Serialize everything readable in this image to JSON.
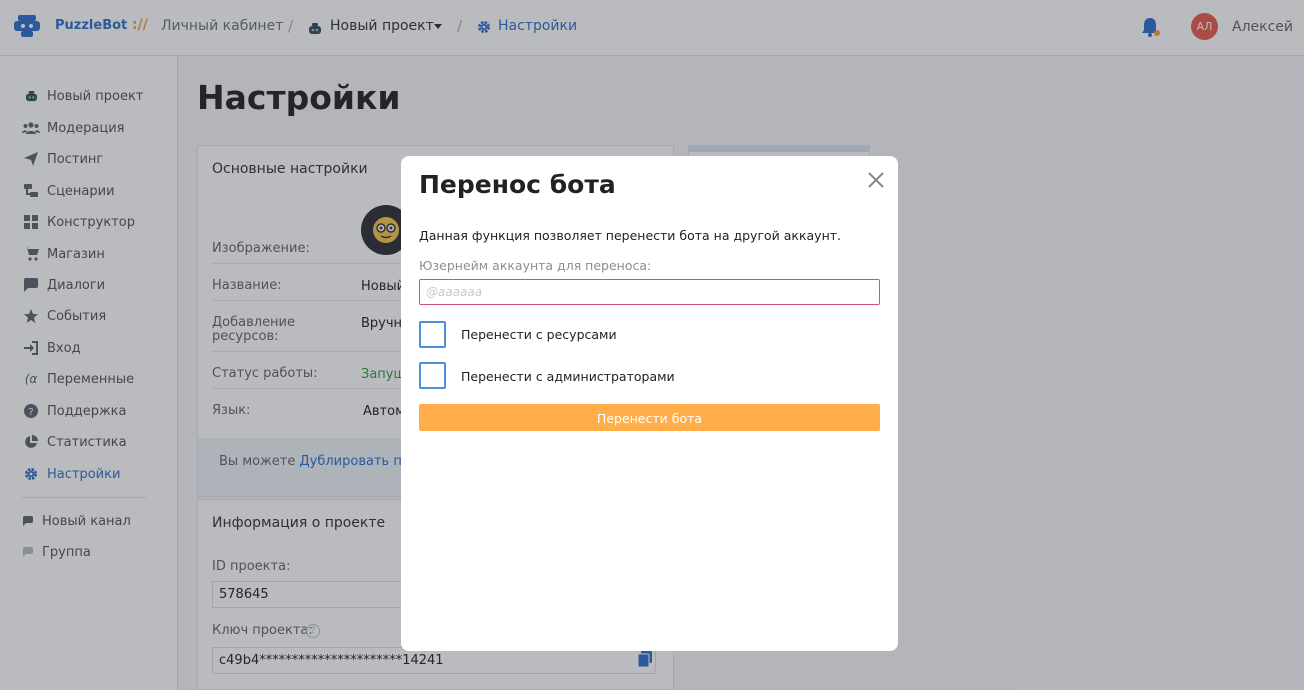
{
  "topbar": {
    "brand": "PuzzleBot",
    "brand_separator": "://",
    "crumb_cabinet": "Личный кабинет",
    "crumb_project": "Новый проект",
    "crumb_settings": "Настройки",
    "separator": "/",
    "avatar_initials": "АЛ",
    "username": "Алексей"
  },
  "sidebar": {
    "items": [
      {
        "label": "Новый проект",
        "icon": "bot-icon"
      },
      {
        "label": "Модерация",
        "icon": "users-icon"
      },
      {
        "label": "Постинг",
        "icon": "send-icon"
      },
      {
        "label": "Сценарии",
        "icon": "scenario-icon"
      },
      {
        "label": "Конструктор",
        "icon": "grid-icon"
      },
      {
        "label": "Магазин",
        "icon": "cart-icon"
      },
      {
        "label": "Диалоги",
        "icon": "chat-icon"
      },
      {
        "label": "События",
        "icon": "star-icon"
      },
      {
        "label": "Вход",
        "icon": "login-icon"
      },
      {
        "label": "Переменные",
        "icon": "variable-icon"
      },
      {
        "label": "Поддержка",
        "icon": "question-icon"
      },
      {
        "label": "Статистика",
        "icon": "pie-icon"
      },
      {
        "label": "Настройки",
        "icon": "gear-icon",
        "active": true
      },
      {
        "label": "Новый канал",
        "icon": "channel-icon"
      },
      {
        "label": "Группа",
        "icon": "group-icon"
      }
    ]
  },
  "main": {
    "title": "Настройки",
    "basic_card": {
      "title": "Основные настройки",
      "rows": [
        {
          "label": "Изображение:",
          "value": ""
        },
        {
          "label": "Название:",
          "value": "Новый"
        },
        {
          "label": "Добавление ресурсов:",
          "value": "Вручну"
        },
        {
          "label": "Статус работы:",
          "value": "Запущ"
        },
        {
          "label": "Язык:",
          "value": "Автом"
        }
      ],
      "footer_text": "Вы можете ",
      "footer_link": "Дублировать прое"
    },
    "info_card": {
      "title": "Информация о проекте",
      "id_label": "ID проекта:",
      "id_value": "578645",
      "key_label": "Ключ проекта:",
      "key_value": "c49b4**********************14241"
    }
  },
  "modal": {
    "title": "Перенос бота",
    "description": "Данная функция позволяет перенести бота на другой аккаунт.",
    "username_label": "Юзернейм аккаунта для переноса:",
    "username_placeholder": "@aaaaaa",
    "username_value": "",
    "checkbox_resources": {
      "label": "Перенести с ресурсами",
      "checked": false
    },
    "checkbox_admins": {
      "label": "Перенести с администраторами",
      "checked": false
    },
    "submit_label": "Перенести бота"
  },
  "colors": {
    "accent": "#2f6fc9",
    "button": "#ffae4a",
    "status_green": "#2e9e44",
    "input_border": "#d6507a",
    "checkbox_border": "#4a8fe0"
  }
}
